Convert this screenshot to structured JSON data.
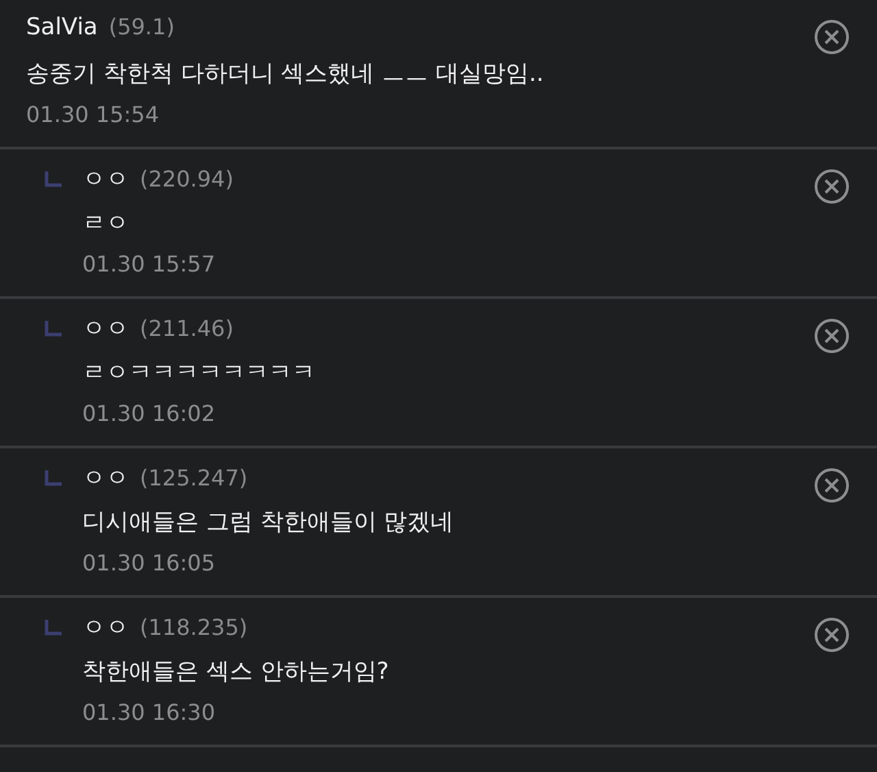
{
  "comments": [
    {
      "kind": "comment",
      "author": "SalVia",
      "score": "(59.1)",
      "text": "송중기 착한척 다하더니 섹스했네 ㅡㅡ 대실망임..",
      "time": "01.30 15:54"
    },
    {
      "kind": "reply",
      "author": "ㅇㅇ",
      "score": "(220.94)",
      "text": "ㄹㅇ",
      "time": "01.30 15:57"
    },
    {
      "kind": "reply",
      "author": "ㅇㅇ",
      "score": "(211.46)",
      "text": "ㄹㅇㅋㅋㅋㅋㅋㅋㅋㅋ",
      "time": "01.30 16:02"
    },
    {
      "kind": "reply",
      "author": "ㅇㅇ",
      "score": "(125.247)",
      "text": "디시애들은 그럼 착한애들이 많겠네",
      "time": "01.30 16:05"
    },
    {
      "kind": "reply",
      "author": "ㅇㅇ",
      "score": "(118.235)",
      "text": "착한애들은 섹스 안하는거임?",
      "time": "01.30 16:30"
    }
  ]
}
